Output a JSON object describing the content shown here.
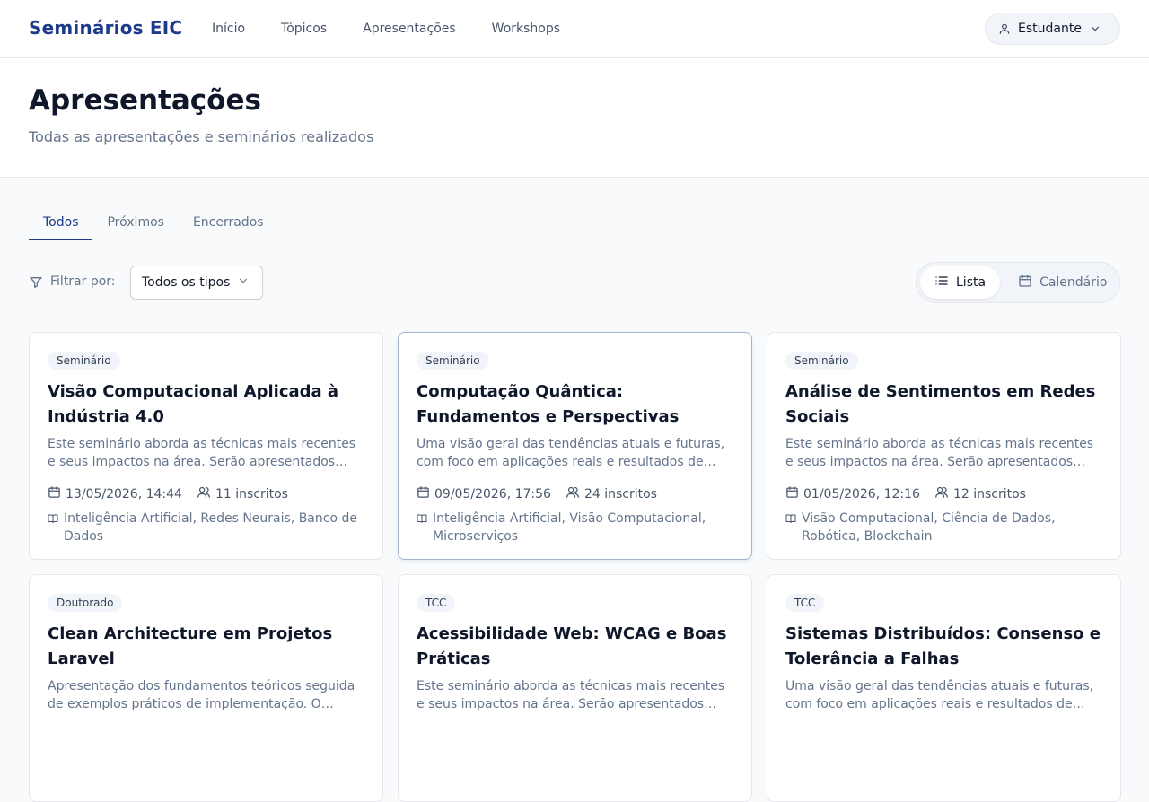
{
  "brand": "Seminários EIC",
  "nav": [
    "Início",
    "Tópicos",
    "Apresentações",
    "Workshops"
  ],
  "user_menu": {
    "label": "Estudante",
    "icon": "user-icon"
  },
  "page": {
    "title": "Apresentações",
    "subtitle": "Todas as apresentações e seminários realizados"
  },
  "tabs": [
    {
      "label": "Todos",
      "active": true
    },
    {
      "label": "Próximos",
      "active": false
    },
    {
      "label": "Encerrados",
      "active": false
    }
  ],
  "filter": {
    "label": "Filtrar por:",
    "selected": "Todos os tipos"
  },
  "view_toggle": {
    "list": "Lista",
    "calendar": "Calendário",
    "active": "list"
  },
  "colors": {
    "brand": "#1e3a8a",
    "muted_text": "#64748b",
    "border": "#e5e7eb",
    "badge_bg": "#f1f5f9"
  },
  "cards": [
    {
      "type": "Seminário",
      "title": "Visão Computacional Aplicada à Indústria 4.0",
      "description": "Este seminário aborda as técnicas mais recentes e seus impactos na área. Serão apresentados…",
      "datetime": "13/05/2026, 14:44",
      "enrolled": "11 inscritos",
      "topics": "Inteligência Artificial, Redes Neurais, Banco de Dados"
    },
    {
      "type": "Seminário",
      "title": "Computação Quântica: Fundamentos e Perspectivas",
      "description": "Uma visão geral das tendências atuais e futuras, com foco em aplicações reais e resultados de…",
      "datetime": "09/05/2026, 17:56",
      "enrolled": "24 inscritos",
      "topics": "Inteligência Artificial, Visão Computacional, Microserviços"
    },
    {
      "type": "Seminário",
      "title": "Análise de Sentimentos em Redes Sociais",
      "description": "Este seminário aborda as técnicas mais recentes e seus impactos na área. Serão apresentados…",
      "datetime": "01/05/2026, 12:16",
      "enrolled": "12 inscritos",
      "topics": "Visão Computacional, Ciência de Dados, Robótica, Blockchain"
    },
    {
      "type": "Doutorado",
      "title": "Clean Architecture em Projetos Laravel",
      "description": "Apresentação dos fundamentos teóricos seguida de exemplos práticos de implementação. O…",
      "datetime": "",
      "enrolled": "",
      "topics": ""
    },
    {
      "type": "TCC",
      "title": "Acessibilidade Web: WCAG e Boas Práticas",
      "description": "Este seminário aborda as técnicas mais recentes e seus impactos na área. Serão apresentados…",
      "datetime": "",
      "enrolled": "",
      "topics": ""
    },
    {
      "type": "TCC",
      "title": "Sistemas Distribuídos: Consenso e Tolerância a Falhas",
      "description": "Uma visão geral das tendências atuais e futuras, com foco em aplicações reais e resultados de…",
      "datetime": "",
      "enrolled": "",
      "topics": ""
    }
  ]
}
